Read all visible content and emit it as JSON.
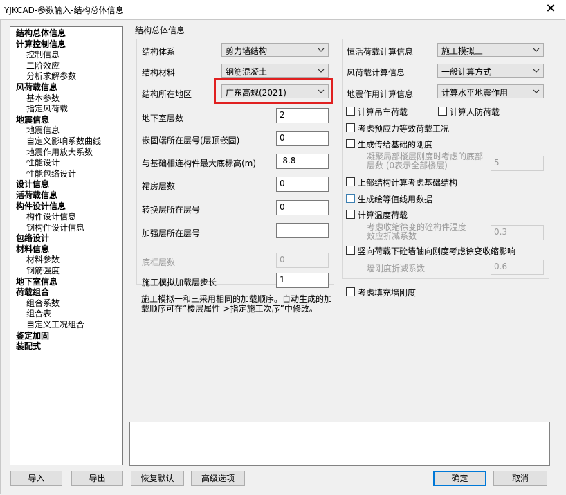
{
  "window": {
    "title": "YJKCAD-参数输入-结构总体信息",
    "close_glyph": "✕"
  },
  "tree": [
    {
      "label": "结构总体信息",
      "level": 0
    },
    {
      "label": "计算控制信息",
      "level": 0
    },
    {
      "label": "控制信息",
      "level": 1
    },
    {
      "label": "二阶效应",
      "level": 1
    },
    {
      "label": "分析求解参数",
      "level": 1
    },
    {
      "label": "风荷载信息",
      "level": 0
    },
    {
      "label": "基本参数",
      "level": 1
    },
    {
      "label": "指定风荷载",
      "level": 1
    },
    {
      "label": "地震信息",
      "level": 0
    },
    {
      "label": "地震信息",
      "level": 1
    },
    {
      "label": "自定义影响系数曲线",
      "level": 1
    },
    {
      "label": "地震作用放大系数",
      "level": 1
    },
    {
      "label": "性能设计",
      "level": 1
    },
    {
      "label": "性能包络设计",
      "level": 1
    },
    {
      "label": "设计信息",
      "level": 0
    },
    {
      "label": "活荷载信息",
      "level": 0
    },
    {
      "label": "构件设计信息",
      "level": 0
    },
    {
      "label": "构件设计信息",
      "level": 1
    },
    {
      "label": "钢构件设计信息",
      "level": 1
    },
    {
      "label": "包络设计",
      "level": 0
    },
    {
      "label": "材料信息",
      "level": 0
    },
    {
      "label": "材料参数",
      "level": 1
    },
    {
      "label": "钢筋强度",
      "level": 1
    },
    {
      "label": "地下室信息",
      "level": 0
    },
    {
      "label": "荷载组合",
      "level": 0
    },
    {
      "label": "组合系数",
      "level": 1
    },
    {
      "label": "组合表",
      "level": 1
    },
    {
      "label": "自定义工况组合",
      "level": 1
    },
    {
      "label": "鉴定加固",
      "level": 0
    },
    {
      "label": "装配式",
      "level": 0
    }
  ],
  "group_title": "结构总体信息",
  "left": {
    "struct_system": {
      "label": "结构体系",
      "value": "剪力墙结构"
    },
    "struct_material": {
      "label": "结构材料",
      "value": "钢筋混凝土"
    },
    "region": {
      "label": "结构所在地区",
      "value": "广东高规(2021)"
    },
    "basement": {
      "label": "地下室层数",
      "value": "2"
    },
    "embed_floor": {
      "label": "嵌固端所在层号(层顶嵌固)",
      "value": "0"
    },
    "base_elev": {
      "label": "与基础相连构件最大底标高(m)",
      "value": "-8.8"
    },
    "podium": {
      "label": "裙房层数",
      "value": "0"
    },
    "transfer": {
      "label": "转换层所在层号",
      "value": "0"
    },
    "strengthen": {
      "label": "加强层所在层号",
      "value": ""
    },
    "frame_floor": {
      "label": "底框层数",
      "value": "0"
    },
    "step": {
      "label": "施工模拟加载层步长",
      "value": "1"
    },
    "note": "施工模拟一和三采用相同的加载顺序。自动生成的加载顺序可在“楼层属性->指定施工次序”中修改。"
  },
  "right": {
    "dead_live": {
      "label": "恒活荷载计算信息",
      "value": "施工模拟三"
    },
    "wind": {
      "label": "风荷载计算信息",
      "value": "一般计算方式"
    },
    "seismic": {
      "label": "地震作用计算信息",
      "value": "计算水平地震作用"
    },
    "crane": "计算吊车荷载",
    "civil_defense": "计算人防荷载",
    "prestress": "考虑预应力等效荷载工况",
    "foundation_stiffness": "生成传给基础的刚度",
    "upper_floors_label": "凝聚局部楼层刚度时考虑的底部层数 (0表示全部楼层)",
    "upper_floors_value": "5",
    "upper_found": "上部结构计算考虑基础结构",
    "contour": "生成绘等值线用数据",
    "temperature": "计算温度荷载",
    "shrink_label": "考虑收缩徐变的砼构件温度效应折减系数",
    "shrink_value": "0.3",
    "creep": "竖向荷载下砼墙轴向刚度考虑徐变收缩影响",
    "wall_reduce_label": "墙刚度折减系数",
    "wall_reduce_value": "0.6",
    "infill": "考虑填充墙刚度"
  },
  "buttons": {
    "import": "导入",
    "export": "导出",
    "restore": "恢复默认",
    "advanced": "高级选项",
    "ok": "确定",
    "cancel": "取消"
  }
}
